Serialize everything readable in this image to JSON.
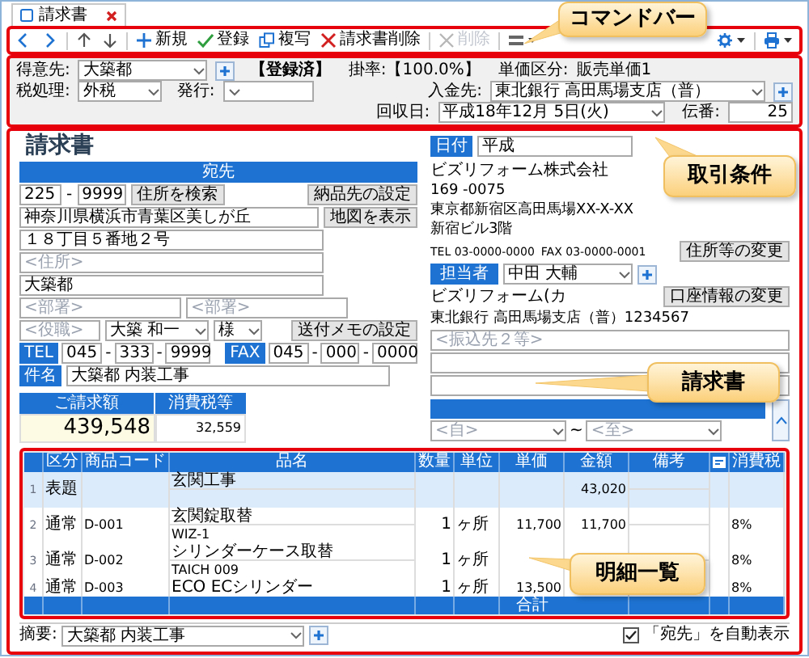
{
  "tab": {
    "label": "請求書",
    "selected": true
  },
  "command_bar": {
    "items": [
      {
        "kind": "back",
        "disabled": false
      },
      {
        "kind": "forward",
        "disabled": false
      },
      {
        "kind": "up",
        "disabled": false
      },
      {
        "kind": "down",
        "disabled": false
      },
      {
        "kind": "new",
        "label": "新規",
        "disabled": false
      },
      {
        "kind": "save",
        "label": "登録",
        "disabled": false
      },
      {
        "kind": "copy",
        "label": "複写",
        "disabled": false
      },
      {
        "kind": "delete_invoice",
        "label": "請求書削除",
        "disabled": false
      },
      {
        "kind": "delete",
        "label": "削除",
        "disabled": true
      },
      {
        "kind": "layout",
        "disabled": false
      },
      {
        "kind": "settings",
        "disabled": false
      },
      {
        "kind": "print",
        "disabled": false
      }
    ]
  },
  "conditions": {
    "customer_label": "得意先:",
    "customer": "大築都",
    "registration": "【登録済】",
    "rate": "掛率:【100.0%】",
    "price_class_label": "単価区分:",
    "price_class": "販売単価1",
    "payee_label": "入金先:",
    "payee": "東北銀行 高田馬場支店（普）",
    "tax_label": "税処理:",
    "tax": "外税",
    "issue_label": "発行:",
    "collection_label": "回収日:",
    "collection_date": "平成18年12月 5日(火)",
    "slip_no_label": "伝番:",
    "slip_no": "25"
  },
  "invoice": {
    "title": "請求書",
    "recipient": {
      "header": "宛先",
      "zip1": "225",
      "zip_separator": "-",
      "zip2": "9999",
      "search_button": "住所を検索",
      "delivery_button": "納品先の設定",
      "address1": "神奈川県横浜市青葉区美しが丘",
      "map_button": "地図を表示",
      "address2": "１８丁目５番地２号",
      "address3_placeholder": "<住所>",
      "name": "大築都",
      "dept1_placeholder": "<部署>",
      "dept2_placeholder": "<部署>",
      "position_placeholder": "<役職>",
      "contact": "大築 和一",
      "honorific": "様",
      "memo_button": "送付メモの設定",
      "tel_label": "TEL",
      "tel": [
        "045",
        "-",
        "333",
        "-",
        "9999"
      ],
      "fax_label": "FAX",
      "fax": [
        "045",
        "-",
        "000",
        "-",
        "0000"
      ],
      "subject_label": "件名",
      "subject": "大築都 内装工事"
    },
    "amounts": {
      "total_label": "ご請求額",
      "total": "439,548",
      "tax_label": "消費税等",
      "tax": "32,559"
    },
    "issuer": {
      "date_label": "日付",
      "date": "平成",
      "company": "ビズリフォーム株式会社",
      "zip": "169 -0075",
      "address1": "東京都新宿区高田馬場XX-X-XX",
      "address2": "新宿ビル3階",
      "tel": "TEL 03-0000-0000",
      "fax": "FAX 03-0000-0001",
      "address_button": "住所等の変更",
      "staff_label": "担当者",
      "staff": "中田 大輔",
      "account_name": "ビズリフォーム(カ",
      "account_button": "口座情報の変更",
      "bank": "東北銀行 高田馬場支店（普）1234567",
      "transfer_placeholder": "<振込先２等>",
      "period_from_placeholder": "<自>",
      "period_separator": "~",
      "period_to_placeholder": "<至>"
    }
  },
  "details": {
    "columns": [
      "区分",
      "商品コード",
      "品名",
      "数量",
      "単位",
      "単価",
      "金額",
      "備考",
      "消費税"
    ],
    "rows": [
      {
        "no": "1",
        "kind_label": "表題",
        "name": "玄関工事",
        "amount": "43,020",
        "heading": true
      },
      {
        "no": "2",
        "kind_label": "通常",
        "code": "D-001",
        "name": "玄関錠取替",
        "spec": "WIZ-1",
        "qty": "1",
        "unit": "ヶ所",
        "price": "11,700",
        "amount": "11,700",
        "tax": "8%",
        "heading": false
      },
      {
        "no": "3",
        "kind_label": "通常",
        "code": "D-002",
        "name": "シリンダーケース取替",
        "spec": "TAICH 009",
        "qty": "1",
        "unit": "ヶ所",
        "tax": "8%",
        "heading": false
      },
      {
        "no": "4",
        "kind_label": "通常",
        "code": "D-003",
        "name": "ECO ECシリンダー",
        "qty": "1",
        "unit": "ヶ所",
        "price": "13,500",
        "tax": "8%",
        "heading": false
      }
    ],
    "footer_label": "合計"
  },
  "bottom": {
    "summary_label": "摘要:",
    "summary": "大築都 内装工事",
    "auto_show": {
      "label": "「宛先」を自動表示",
      "checked": true
    }
  },
  "callouts": [
    {
      "label": "コマンドバー"
    },
    {
      "label": "取引条件"
    },
    {
      "label": "請求書"
    },
    {
      "label": "明細一覧"
    }
  ]
}
